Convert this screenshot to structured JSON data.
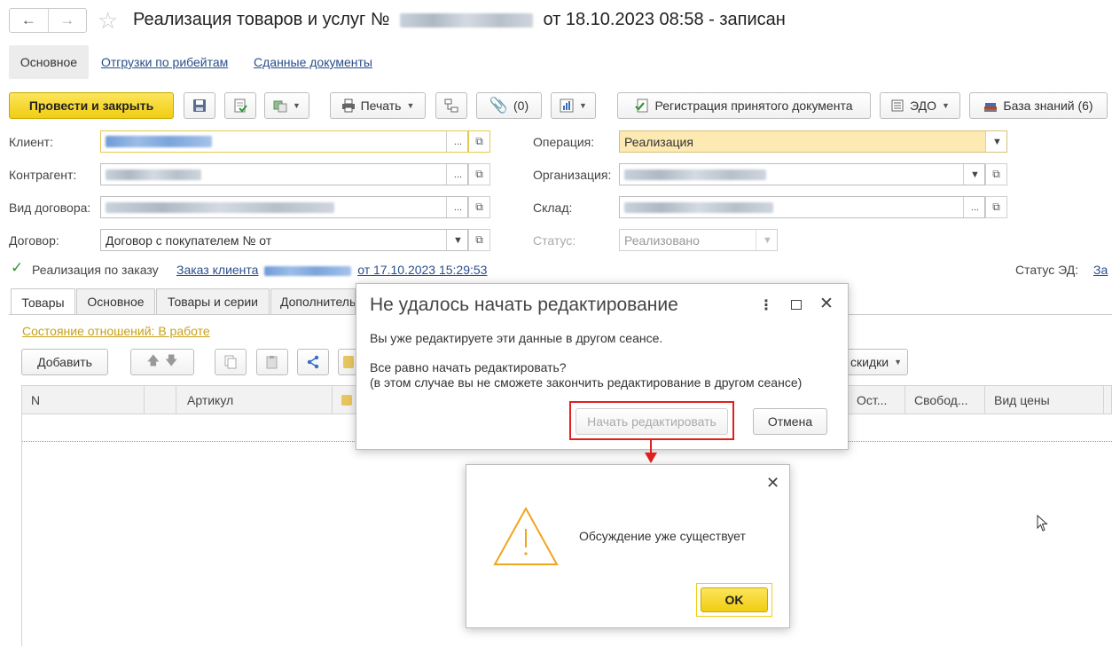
{
  "window": {
    "title_prefix": "Реализация товаров и услуг №",
    "title_suffix": "от 18.10.2023 08:58 - записан"
  },
  "form_tabs": [
    "Основное",
    "Отгрузки по рибейтам",
    "Сданные документы"
  ],
  "toolbar": {
    "post_close": "Провести и закрыть",
    "print": "Печать",
    "attachments": "(0)",
    "register": "Регистрация принятого документа",
    "edo": "ЭДО",
    "knowledge": "База знаний (6)"
  },
  "fields": {
    "client_label": "Клиент:",
    "counterparty_label": "Контрагент:",
    "contract_kind_label": "Вид договора:",
    "contract_label": "Договор:",
    "contract_value": "Договор с покупателем №  от",
    "operation_label": "Операция:",
    "operation_value": "Реализация",
    "organization_label": "Организация:",
    "warehouse_label": "Склад:",
    "status_label": "Статус:",
    "status_value": "Реализовано"
  },
  "order": {
    "checkbox_label": "Реализация по заказу",
    "link_prefix": "Заказ клиента",
    "link_suffix": "от 17.10.2023 15:29:53",
    "ed_status_label": "Статус ЭД:",
    "ed_status_link": "За"
  },
  "lower_tabs": [
    "Товары",
    "Основное",
    "Товары и серии",
    "Дополнитель"
  ],
  "goods": {
    "relations": "Состояние отношений: В работе",
    "add": "Добавить",
    "discounts": "скидки",
    "columns": [
      "N",
      "Артикул",
      "Ост...",
      "Свобод...",
      "Вид цены"
    ]
  },
  "dialog_edit": {
    "title": "Не удалось начать редактирование",
    "line1": "Вы уже редактируете эти данные в другом сеансе.",
    "line2": "Все равно начать редактировать?",
    "line3": "(в этом случае вы не сможете закончить редактирование в другом сеансе)",
    "start_btn": "Начать редактировать",
    "cancel_btn": "Отмена"
  },
  "dialog_msg": {
    "text": "Обсуждение уже существует",
    "ok": "OK"
  },
  "colors": {
    "accent_yellow": "#f2cd11",
    "link_blue": "#2a4e8c",
    "highlight_red": "#e0201e",
    "warning_orange": "#f0a51e"
  }
}
